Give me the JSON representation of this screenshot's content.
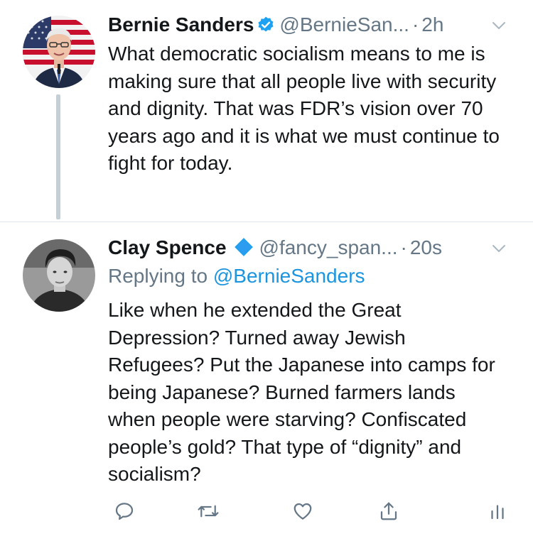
{
  "tweet1": {
    "name": "Bernie Sanders",
    "handle": "@BernieSan...",
    "separator": "·",
    "time": "2h",
    "text": "What democratic socialism means to me is making sure that all people live with security and dignity. That was FDR’s vision over 70 years ago and it is what we must continue to fight for today.",
    "verified_color": "#1da1f2"
  },
  "tweet2": {
    "name": "Clay Spence",
    "handle": "@fancy_span...",
    "separator": "·",
    "time": "20s",
    "replying_prefix": "Replying to",
    "replying_to": "@BernieSanders",
    "text": "Like when he extended the Great Depression? Turned away Jewish Refugees? Put the Japanese into camps for being Japanese? Burned farmers lands when people were starving? Confiscated people’s gold? That type of “dignity” and socialism?",
    "badge_color": "#1da1f2"
  },
  "actions": [
    {
      "icon": "reply-icon"
    },
    {
      "icon": "retweet-icon"
    },
    {
      "icon": "like-icon"
    },
    {
      "icon": "share-icon"
    },
    {
      "icon": "analytics-icon"
    }
  ],
  "colors": {
    "text": "#14171a",
    "secondary": "#657786",
    "link": "#1b95e0",
    "divider": "#e1e8ed",
    "thread_line": "#c4cfd6"
  }
}
